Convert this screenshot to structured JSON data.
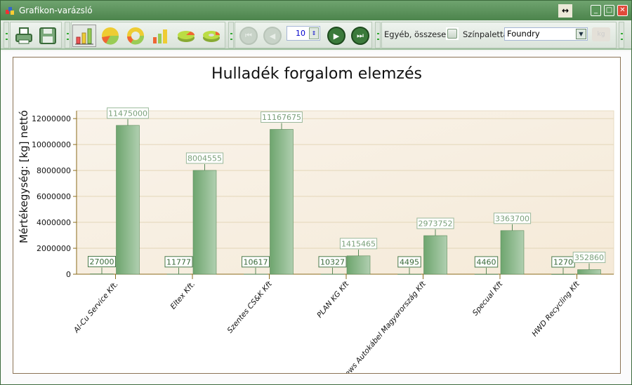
{
  "window": {
    "title": "Grafikon-varázsló",
    "resize_icon": "↔",
    "minimize": "_",
    "maximize": "□",
    "close": "✕"
  },
  "toolbar": {
    "icons": [
      "print-icon",
      "save-icon",
      "bar-chart-icon",
      "pie-chart-icon",
      "doughnut-chart-icon",
      "3d-bar-chart-icon",
      "3d-pie-chart-icon",
      "3d-doughnut-chart-icon"
    ],
    "selected_chart": "bar-chart-icon",
    "page_count": "10",
    "others_label": "Egyéb, összesen",
    "others_checked": false,
    "palette_label": "Színpaletta",
    "palette_value": "Foundry"
  },
  "colors": {
    "bar": "#6ea56e",
    "bar_light": "#b0cfb0",
    "plot_bg": "#f7efe2",
    "axis": "#8b6b1b",
    "titlebar": "#5a925a"
  },
  "chart_data": {
    "type": "bar",
    "title": "Hulladék forgalom elemzés",
    "xlabel": "",
    "ylabel": "Mértékegység: [kg] nettó",
    "ylim": [
      0,
      12600000
    ],
    "yticks": [
      0,
      2000000,
      4000000,
      6000000,
      8000000,
      10000000,
      12000000
    ],
    "ytick_labels": [
      "0",
      "2000000",
      "4000000",
      "6000000",
      "8000000",
      "10000000",
      "12000000"
    ],
    "grid": true,
    "legend": "none",
    "categories": [
      "Al-Cu Service Kft.",
      "Eltex Kft.",
      "Szentes CS&K Kft",
      "PLAN KG Kft",
      "Sews Autokábel Magyarország Kft",
      "Specual Kft",
      "HWD Recycling Kft"
    ],
    "series": [
      {
        "values": [
          27000,
          11777,
          10617,
          10327,
          4495,
          4460,
          1270
        ]
      },
      {
        "values": [
          11475000,
          8004555,
          11167675,
          1415465,
          2973752,
          3363700,
          352860
        ]
      }
    ]
  }
}
